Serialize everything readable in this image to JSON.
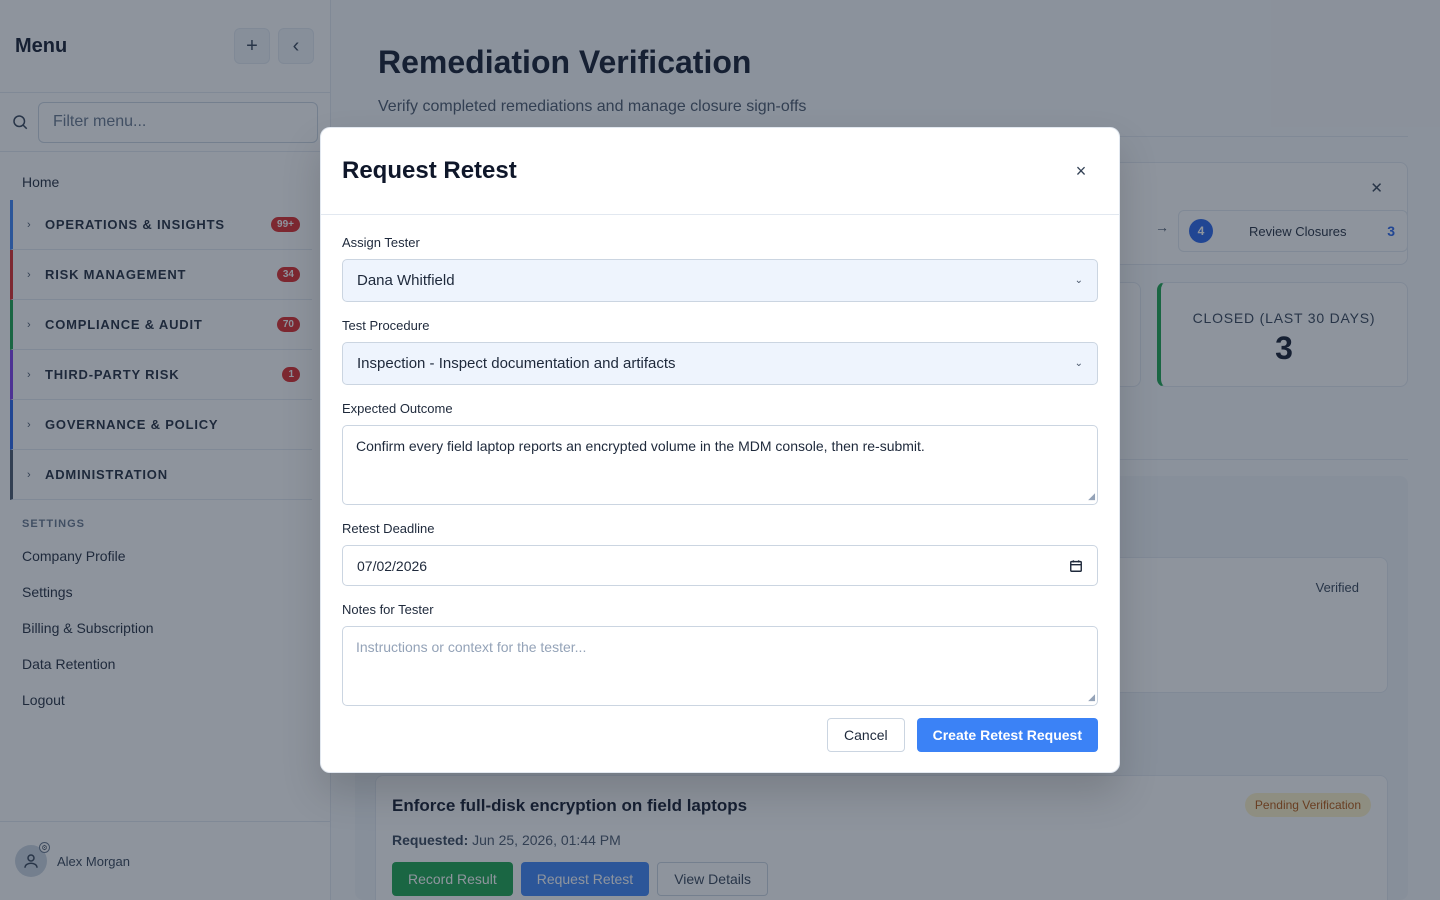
{
  "sidebar": {
    "title": "Menu",
    "add_label": "+",
    "collapse_label": "‹",
    "filter_placeholder": "Filter menu...",
    "home": "Home",
    "groups": [
      {
        "label": "OPERATIONS & INSIGHTS",
        "badge": "99+",
        "color": "#3b82f6"
      },
      {
        "label": "RISK MANAGEMENT",
        "badge": "34",
        "color": "#dc2626"
      },
      {
        "label": "COMPLIANCE & AUDIT",
        "badge": "70",
        "color": "#16a34a"
      },
      {
        "label": "THIRD-PARTY RISK",
        "badge": "1",
        "color": "#7c3aed"
      },
      {
        "label": "GOVERNANCE & POLICY",
        "badge": "",
        "color": "#2563eb"
      },
      {
        "label": "ADMINISTRATION",
        "badge": "",
        "color": "#475569"
      }
    ],
    "settings_label": "SETTINGS",
    "settings_links": [
      "Company Profile",
      "Settings",
      "Billing & Subscription",
      "Data Retention",
      "Logout"
    ],
    "user_name": "Alex Morgan"
  },
  "main": {
    "title": "Remediation Verification",
    "subtitle": "Verify completed remediations and manage closure sign-offs",
    "step": {
      "number": "4",
      "label": "Review Closures",
      "count": "3",
      "arrow": "→"
    },
    "stat": {
      "label": "CLOSED (LAST 30 DAYS)",
      "value": "3"
    },
    "verified_label": "Verified",
    "item": {
      "title": "Enforce full-disk encryption on field laptops",
      "status": "Pending Verification",
      "requested_label": "Requested:",
      "requested_value": "Jun 25, 2026, 01:44 PM",
      "actions": [
        "Record Result",
        "Request Retest",
        "View Details"
      ]
    }
  },
  "modal": {
    "title": "Request Retest",
    "close": "×",
    "assign_tester_label": "Assign Tester",
    "assign_tester_value": "Dana Whitfield",
    "procedure_label": "Test Procedure",
    "procedure_value": "Inspection - Inspect documentation and artifacts",
    "outcome_label": "Expected Outcome",
    "outcome_value": "Confirm every field laptop reports an encrypted volume in the MDM console, then re-submit.",
    "deadline_label": "Retest Deadline",
    "deadline_value": "07/02/2026",
    "notes_label": "Notes for Tester",
    "notes_placeholder": "Instructions or context for the tester...",
    "cancel": "Cancel",
    "submit": "Create Retest Request"
  },
  "colors": {
    "accent": "#3b82f6",
    "success": "#16a34a",
    "danger": "#dc2626",
    "warning": "#b45309"
  }
}
